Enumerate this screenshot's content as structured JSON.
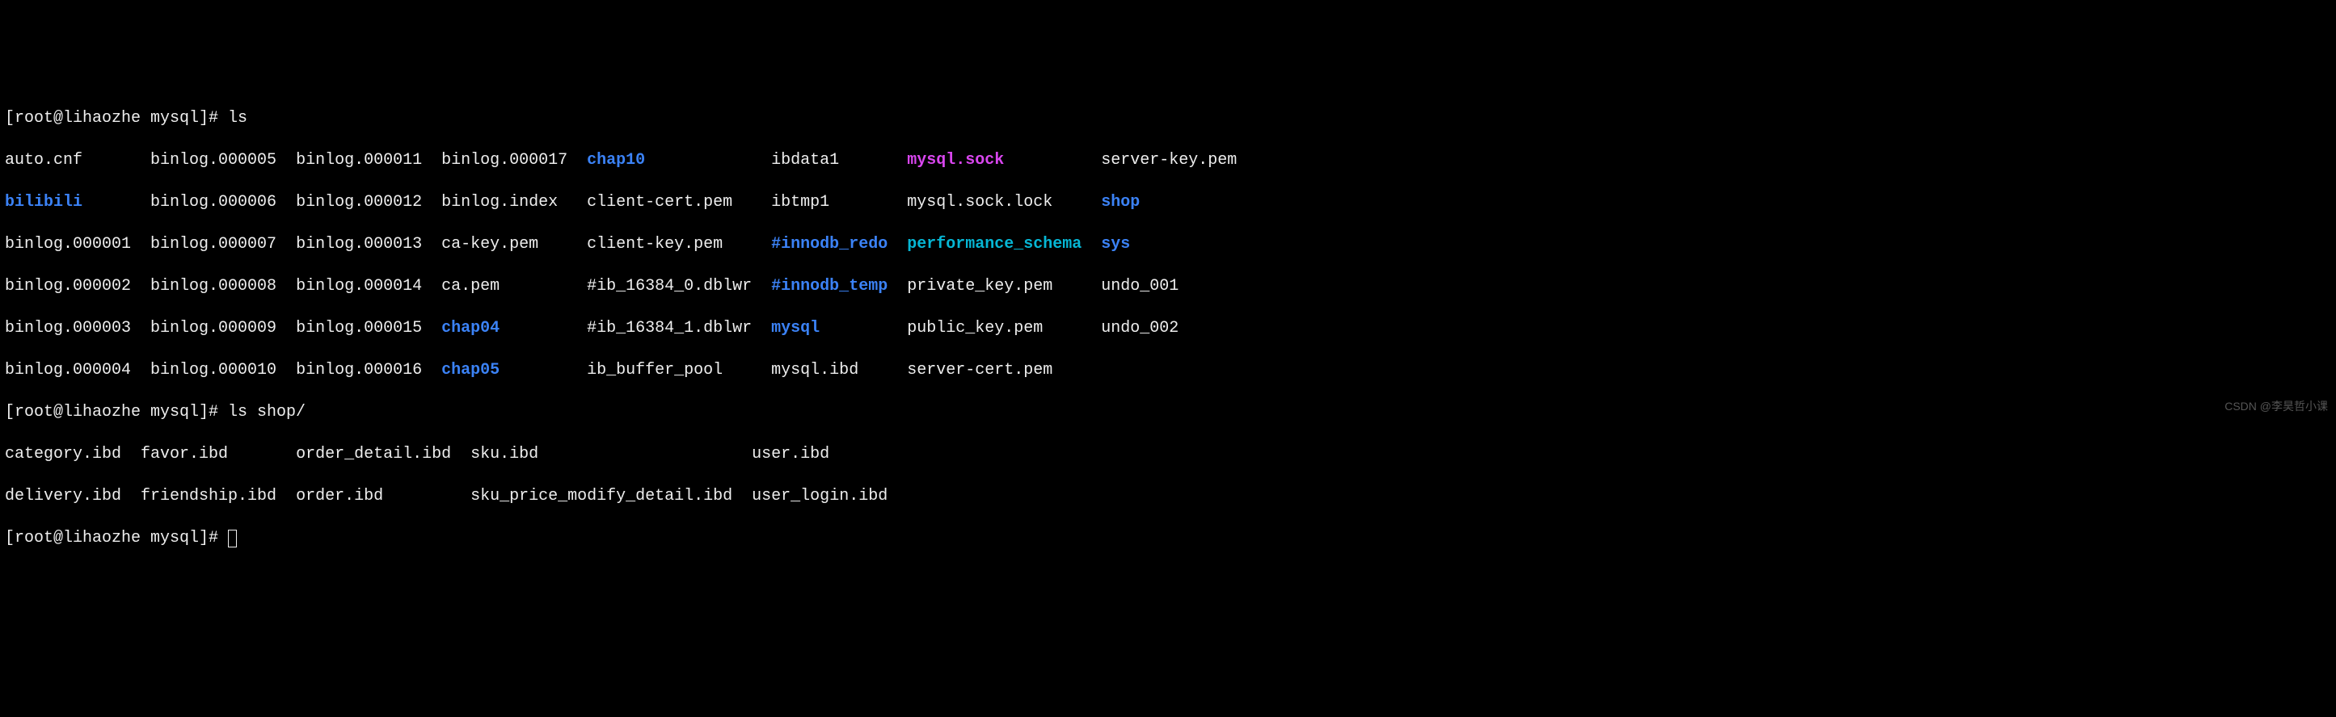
{
  "prompts": {
    "p1_user": "[root@lihaozhe mysql]# ",
    "p1_cmd": "ls",
    "p2_user": "[root@lihaozhe mysql]# ",
    "p2_cmd": "ls shop/",
    "p3_user": "[root@lihaozhe mysql]# "
  },
  "ls1": {
    "r1": {
      "c1": "auto.cnf",
      "c2": "binlog.000005",
      "c3": "binlog.000011",
      "c4": "binlog.000017",
      "c5": "chap10",
      "c6": "ibdata1",
      "c7": "mysql.sock",
      "c8": "server-key.pem"
    },
    "r2": {
      "c1": "bilibili",
      "c2": "binlog.000006",
      "c3": "binlog.000012",
      "c4": "binlog.index",
      "c5": "client-cert.pem",
      "c6": "ibtmp1",
      "c7": "mysql.sock.lock",
      "c8": "shop"
    },
    "r3": {
      "c1": "binlog.000001",
      "c2": "binlog.000007",
      "c3": "binlog.000013",
      "c4": "ca-key.pem",
      "c5": "client-key.pem",
      "c6": "#innodb_redo",
      "c7": "performance_schema",
      "c8": "sys"
    },
    "r4": {
      "c1": "binlog.000002",
      "c2": "binlog.000008",
      "c3": "binlog.000014",
      "c4": "ca.pem",
      "c5": "#ib_16384_0.dblwr",
      "c6": "#innodb_temp",
      "c7": "private_key.pem",
      "c8": "undo_001"
    },
    "r5": {
      "c1": "binlog.000003",
      "c2": "binlog.000009",
      "c3": "binlog.000015",
      "c4": "chap04",
      "c5": "#ib_16384_1.dblwr",
      "c6": "mysql",
      "c7": "public_key.pem",
      "c8": "undo_002"
    },
    "r6": {
      "c1": "binlog.000004",
      "c2": "binlog.000010",
      "c3": "binlog.000016",
      "c4": "chap05",
      "c5": "ib_buffer_pool",
      "c6": "mysql.ibd",
      "c7": "server-cert.pem",
      "c8": ""
    }
  },
  "ls2": {
    "r1": {
      "c1": "category.ibd",
      "c2": "favor.ibd",
      "c3": "order_detail.ibd",
      "c4": "sku.ibd",
      "c5": "user.ibd"
    },
    "r2": {
      "c1": "delivery.ibd",
      "c2": "friendship.ibd",
      "c3": "order.ibd",
      "c4": "sku_price_modify_detail.ibd",
      "c5": "user_login.ibd"
    }
  },
  "watermark": "CSDN @李昊哲小课"
}
